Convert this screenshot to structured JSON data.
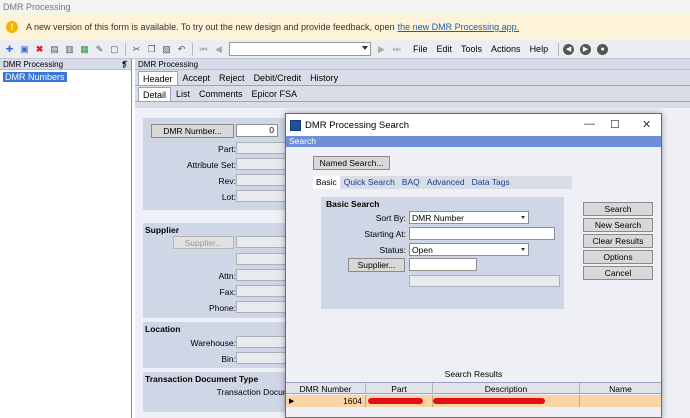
{
  "window": {
    "title": "DMR Processing"
  },
  "banner": {
    "message": "A new version of this form is available. To try out the new design and provide feedback, open",
    "link_text": "the new DMR Processing app."
  },
  "toolbar": {
    "menu": [
      "File",
      "Edit",
      "Tools",
      "Actions",
      "Help"
    ]
  },
  "left_pane": {
    "title": "DMR Processing",
    "pin": "❡",
    "tree_item": "DMR Numbers"
  },
  "right_pane": {
    "title": "DMR Processing",
    "main_tabs": [
      "Header",
      "Accept",
      "Reject",
      "Debit/Credit",
      "History"
    ],
    "sub_tabs": [
      "Detail",
      "List",
      "Comments",
      "Epicor FSA"
    ],
    "dmr_button": "DMR Number...",
    "dmr_value": "0",
    "labels": {
      "part": "Part:",
      "attribute_set": "Attribute Set:",
      "rev": "Rev:",
      "lot": "Lot:"
    },
    "supplier": {
      "title": "Supplier",
      "button": "Supplier...",
      "attn": "Attn:",
      "fax": "Fax:",
      "phone": "Phone:"
    },
    "location": {
      "title": "Location",
      "warehouse": "Warehouse:",
      "bin": "Bin:"
    },
    "transaction": {
      "title": "Transaction Document Type",
      "label": "Transaction Docum"
    }
  },
  "dialog": {
    "title": "DMR Processing Search",
    "caption": "Search",
    "named_search": "Named Search...",
    "tabs": [
      "Basic",
      "Quick Search",
      "BAQ",
      "Advanced",
      "Data Tags"
    ],
    "basic": {
      "title": "Basic Search",
      "sort_by_label": "Sort By:",
      "sort_by_value": "DMR Number",
      "starting_at_label": "Starting At:",
      "starting_at_value": "",
      "status_label": "Status:",
      "status_value": "Open",
      "supplier_button": "Supplier..."
    },
    "buttons": [
      "Search",
      "New Search",
      "Clear Results",
      "Options",
      "Cancel"
    ],
    "results": {
      "label": "Search Results",
      "columns": [
        "DMR Number",
        "Part",
        "Description",
        "Name"
      ],
      "rows": [
        {
          "dmr_number": "1604"
        }
      ]
    }
  },
  "colors": {
    "banner_bg": "#fdf3d8",
    "caption_bg": "#6e8fd6",
    "selected_row": "#f8d4a6",
    "redaction": "#e41010"
  }
}
